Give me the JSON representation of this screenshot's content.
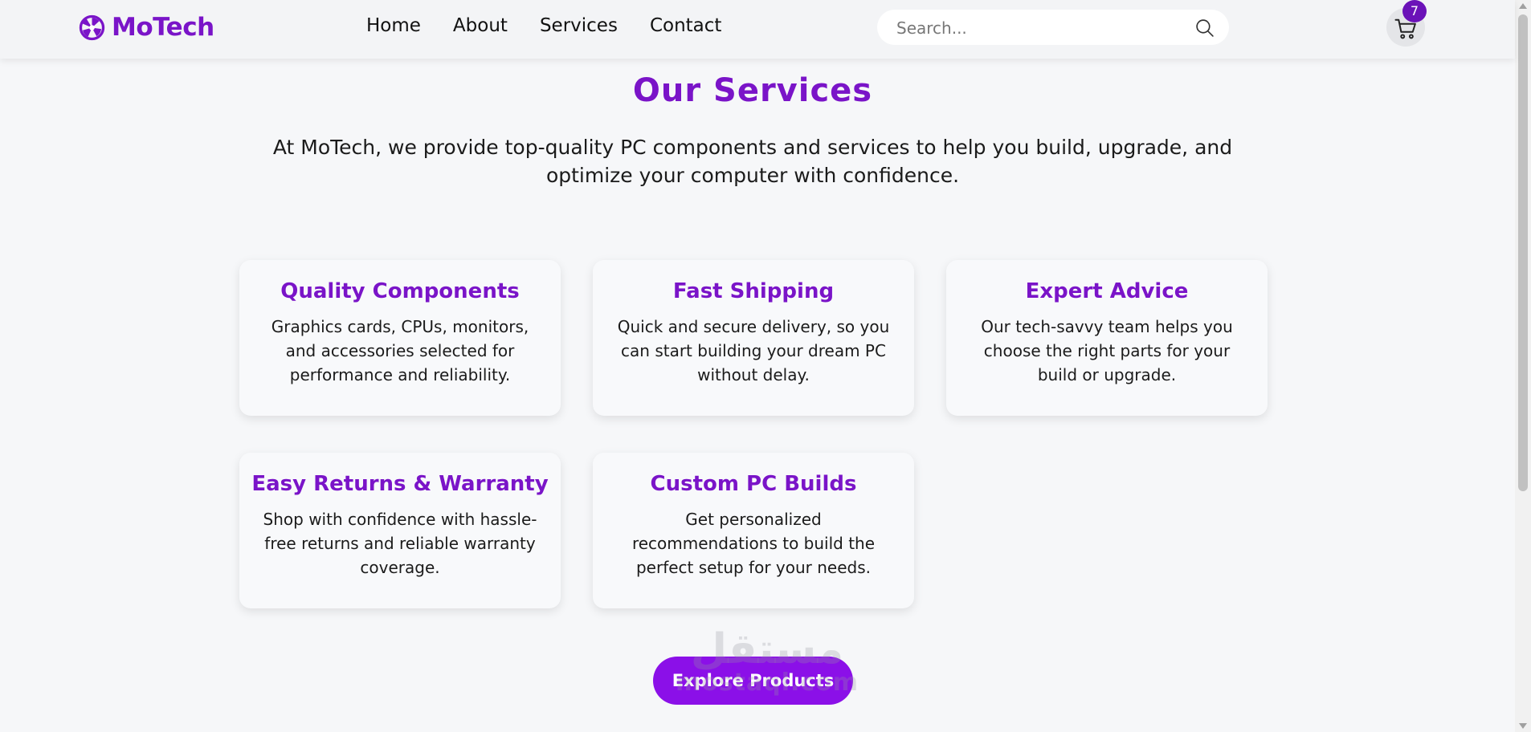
{
  "header": {
    "logo_text": "MoTech",
    "nav": [
      "Home",
      "About",
      "Services",
      "Contact"
    ],
    "search_placeholder": "Search...",
    "cart_count": "7"
  },
  "main": {
    "title": "Our Services",
    "intro": "At MoTech, we provide top-quality PC components and services to help you build, upgrade, and optimize your computer with confidence.",
    "cards": [
      {
        "title": "Quality Components",
        "text": "Graphics cards, CPUs, monitors, and accessories selected for performance and reliability."
      },
      {
        "title": "Fast Shipping",
        "text": "Quick and secure delivery, so you can start building your dream PC without delay."
      },
      {
        "title": "Expert Advice",
        "text": "Our tech-savvy team helps you choose the right parts for your build or upgrade."
      },
      {
        "title": "Easy Returns & Warranty",
        "text": "Shop with confidence with hassle-free returns and reliable warranty coverage."
      },
      {
        "title": "Custom PC Builds",
        "text": "Get personalized recommendations to build the perfect setup for your needs."
      }
    ],
    "cta_label": "Explore Products"
  },
  "watermark": {
    "arabic": "مستقل",
    "latin": "mostaql.com"
  },
  "colors": {
    "accent": "#7a14c8",
    "button": "#8b10e8",
    "badge": "#6b12b8",
    "background": "#f6f7f9"
  }
}
